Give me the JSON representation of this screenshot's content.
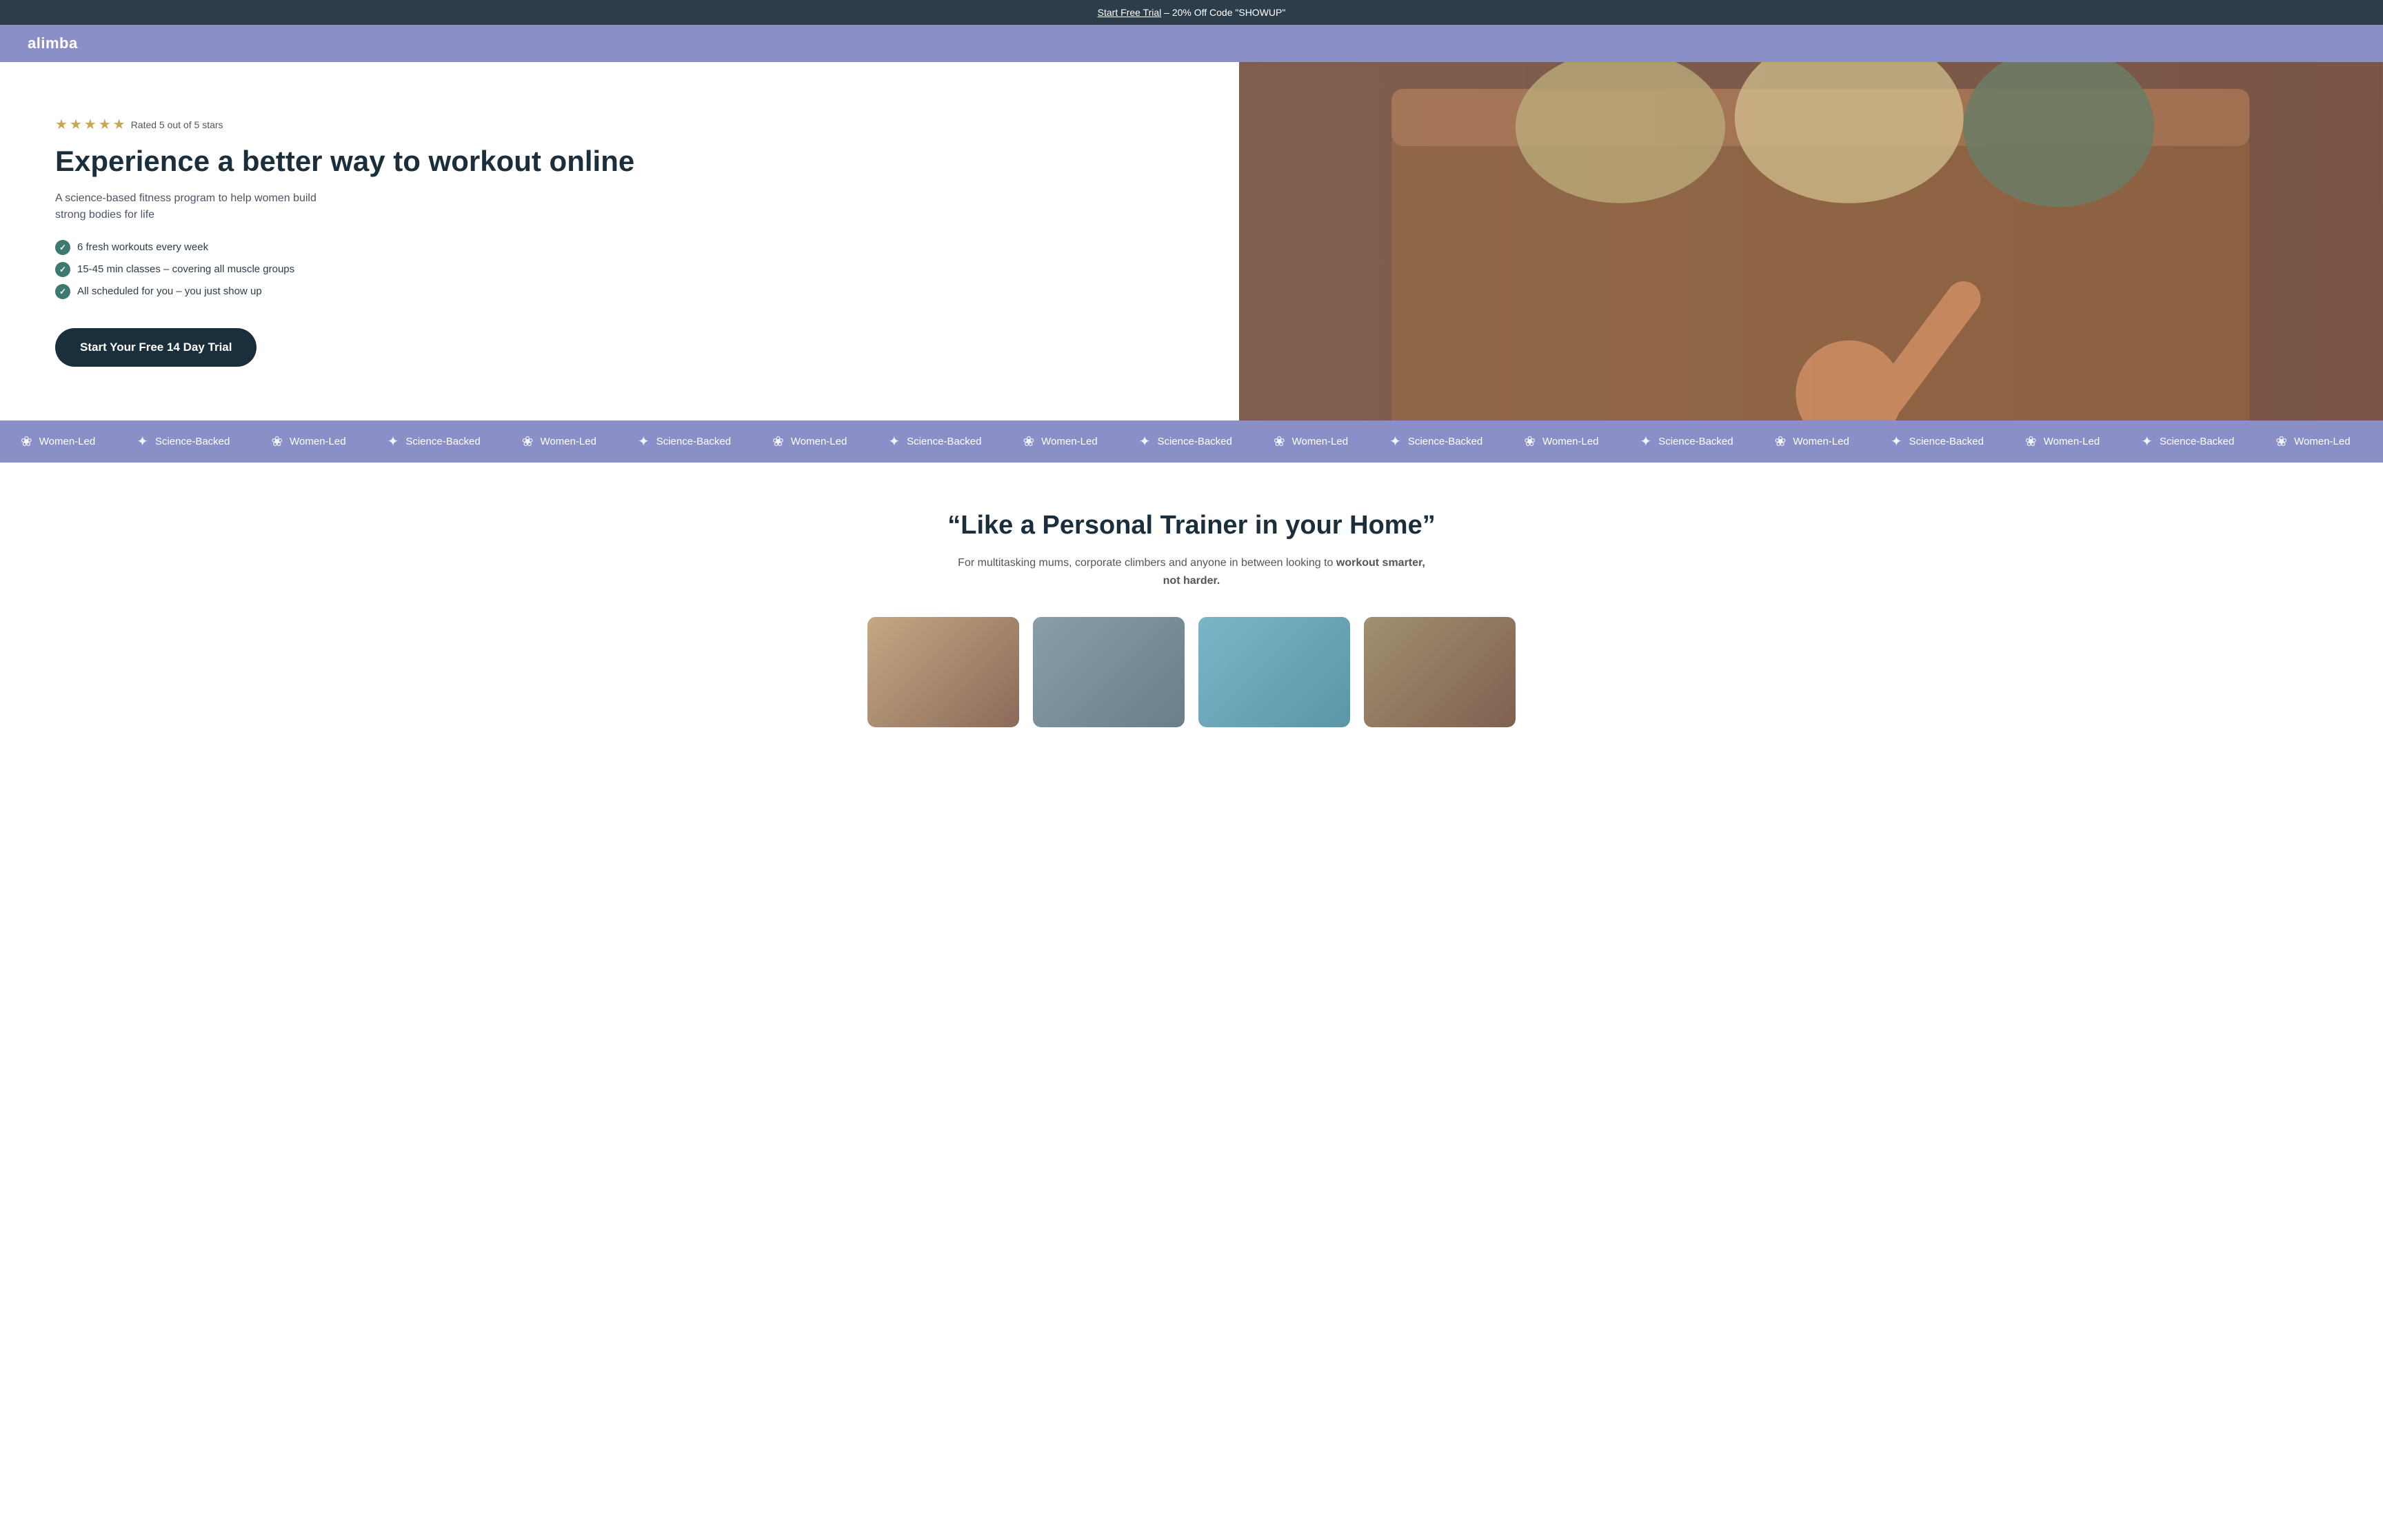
{
  "announcement": {
    "cta_link": "Start Free Trial",
    "rest_text": " – 20% Off Code \"SHOWUP\""
  },
  "nav": {
    "logo": "alimba"
  },
  "hero": {
    "rating": {
      "stars": 5,
      "label": "Rated 5 out of 5 stars"
    },
    "headline": "Experience a better way to workout online",
    "subtext": "A science-based fitness program to help women build strong bodies for life",
    "features": [
      "6 fresh workouts every week",
      "15-45 min classes – covering all muscle groups",
      "All scheduled for you – you just show up"
    ],
    "cta_button": "Start Your Free 14 Day Trial"
  },
  "ticker": {
    "items": [
      {
        "icon": "❀",
        "label": "Women-Led"
      },
      {
        "icon": "✦",
        "label": "Science-Backed"
      },
      {
        "icon": "❀",
        "label": "Women-Led"
      },
      {
        "icon": "✦",
        "label": "Science-Backed"
      },
      {
        "icon": "❀",
        "label": "Women-Led"
      },
      {
        "icon": "✦",
        "label": "Science-Backed"
      },
      {
        "icon": "❀",
        "label": "Women-Led"
      },
      {
        "icon": "✦",
        "label": "Science-Backed"
      },
      {
        "icon": "❀",
        "label": "Women-Led"
      },
      {
        "icon": "✦",
        "label": "Science-Backed"
      },
      {
        "icon": "❀",
        "label": "Women-Led"
      },
      {
        "icon": "✦",
        "label": "Science-Backed"
      }
    ]
  },
  "quote_section": {
    "headline": "“Like a Personal Trainer in your Home”",
    "subtext_plain": "For multitasking mums, corporate climbers and anyone in between looking to ",
    "subtext_bold": "workout smarter, not harder.",
    "thumbnails": [
      {
        "id": "thumb-1"
      },
      {
        "id": "thumb-2"
      },
      {
        "id": "thumb-3"
      },
      {
        "id": "thumb-4"
      }
    ]
  }
}
